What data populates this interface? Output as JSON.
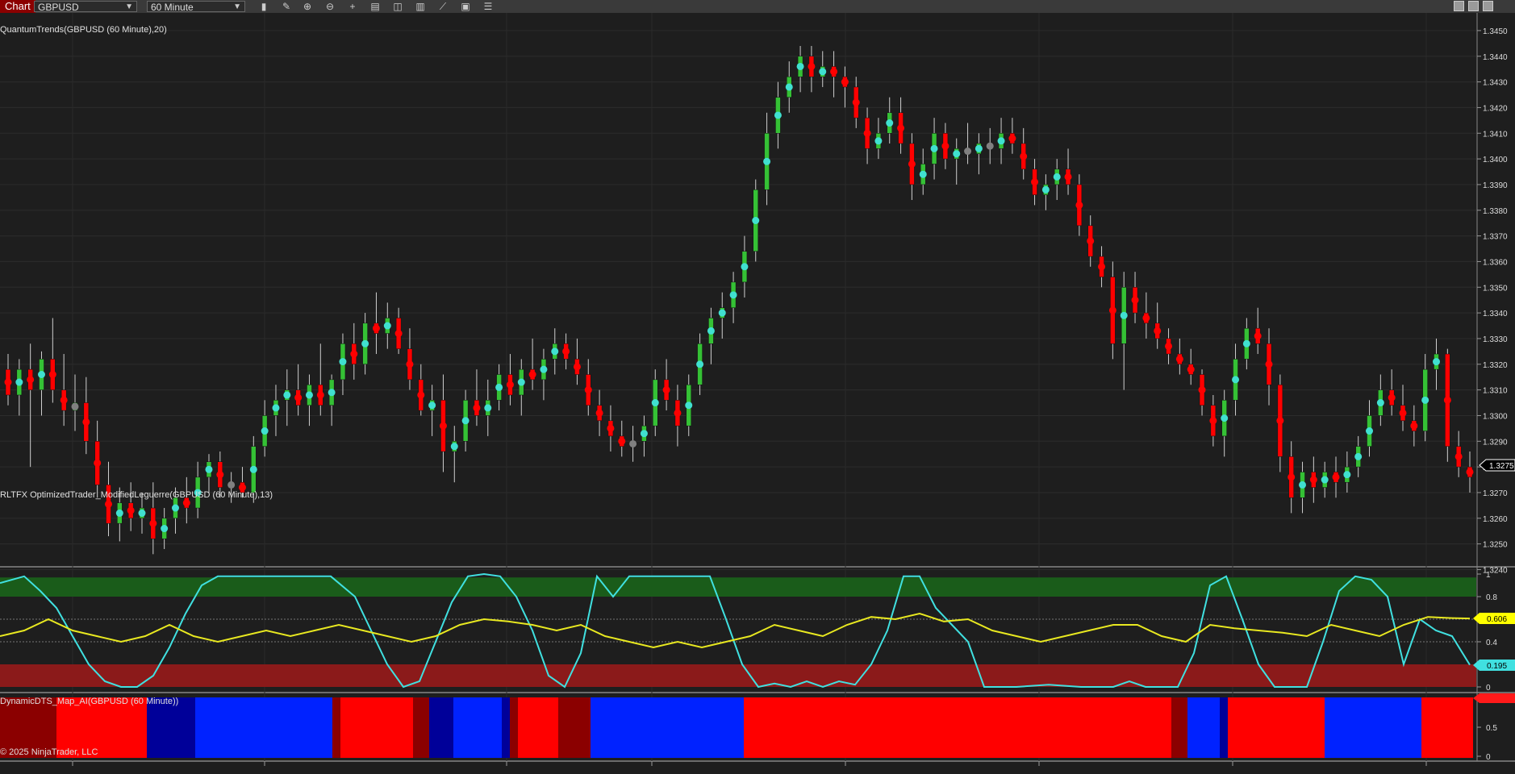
{
  "toolbar": {
    "tab_label": "Chart",
    "instrument": "GBPUSD",
    "interval": "60 Minute",
    "icons": [
      "bar-type-icon",
      "pencil-icon",
      "zoom-in-icon",
      "zoom-out-icon",
      "crosshair-icon",
      "properties-icon",
      "strategies-icon",
      "indicators-icon",
      "drawing-tools-icon",
      "data-box-icon",
      "list-icon"
    ]
  },
  "panels": {
    "price": {
      "label": "QuantumTrends(GBPUSD (60 Minute),20)",
      "ticks": [
        "1.3450",
        "1.3440",
        "1.3430",
        "1.3420",
        "1.3410",
        "1.3400",
        "1.3390",
        "1.3380",
        "1.3370",
        "1.3360",
        "1.3350",
        "1.3340",
        "1.3330",
        "1.3320",
        "1.3310",
        "1.3300",
        "1.3290",
        "1.3280",
        "1.3270",
        "1.3260",
        "1.3250",
        "1.3240"
      ],
      "last_price": "1.3275"
    },
    "oscillator": {
      "label": "RLTFX OptimizedTrader_ModifiedLeguerre(GBPUSD (60 Minute),13)",
      "ticks": [
        "1",
        "0.8",
        "0.6",
        "0.4",
        "0.2",
        "0"
      ],
      "yellow_value": "0.606",
      "cyan_value": "0.195"
    },
    "map": {
      "label": "DynamicDTS_Map_AI(GBPUSD (60 Minute))",
      "copyright": "© 2025 NinjaTrader, LLC",
      "ticks": [
        "1",
        "0.5",
        "0"
      ]
    }
  },
  "colors": {
    "up": "#35c135",
    "down": "#ff0000",
    "dot_up": "#40e0d0",
    "dot_down": "#ff0000",
    "dot_neutral": "#808080",
    "map_blue": "#0022ff",
    "map_navy": "#000099",
    "map_red": "#ff0000",
    "map_darkred": "#8b0000"
  },
  "chart_data": {
    "type": "candlestick",
    "instrument": "GBPUSD",
    "interval": "60 Minute",
    "ylim": [
      1.3237,
      1.3455
    ],
    "candles_ohlc": [
      [
        1.3318,
        1.3324,
        1.3304,
        1.3308
      ],
      [
        1.3308,
        1.3322,
        1.33,
        1.3318
      ],
      [
        1.3318,
        1.3328,
        1.328,
        1.331
      ],
      [
        1.331,
        1.3325,
        1.33,
        1.3322
      ],
      [
        1.3322,
        1.3338,
        1.3305,
        1.331
      ],
      [
        1.331,
        1.3324,
        1.3296,
        1.3302
      ],
      [
        1.3302,
        1.3316,
        1.3294,
        1.3305
      ],
      [
        1.3305,
        1.3315,
        1.3285,
        1.329
      ],
      [
        1.329,
        1.3298,
        1.3268,
        1.3273
      ],
      [
        1.3273,
        1.3282,
        1.3253,
        1.3258
      ],
      [
        1.3258,
        1.3272,
        1.3251,
        1.3266
      ],
      [
        1.3266,
        1.3274,
        1.3255,
        1.326
      ],
      [
        1.326,
        1.327,
        1.3254,
        1.3264
      ],
      [
        1.3264,
        1.3274,
        1.3246,
        1.3252
      ],
      [
        1.3252,
        1.3264,
        1.3248,
        1.326
      ],
      [
        1.326,
        1.3272,
        1.3254,
        1.3268
      ],
      [
        1.3268,
        1.3276,
        1.3258,
        1.3264
      ],
      [
        1.3264,
        1.3282,
        1.326,
        1.3276
      ],
      [
        1.3276,
        1.3285,
        1.327,
        1.3282
      ],
      [
        1.3282,
        1.3286,
        1.3268,
        1.3272
      ],
      [
        1.3272,
        1.3278,
        1.3266,
        1.3274
      ],
      [
        1.3274,
        1.328,
        1.3268,
        1.327
      ],
      [
        1.327,
        1.3292,
        1.3266,
        1.3288
      ],
      [
        1.3288,
        1.3306,
        1.3284,
        1.33
      ],
      [
        1.33,
        1.3312,
        1.3292,
        1.3306
      ],
      [
        1.3306,
        1.3318,
        1.3296,
        1.331
      ],
      [
        1.331,
        1.332,
        1.33,
        1.3304
      ],
      [
        1.3304,
        1.3316,
        1.3296,
        1.3312
      ],
      [
        1.3312,
        1.3328,
        1.33,
        1.3304
      ],
      [
        1.3304,
        1.3316,
        1.3296,
        1.3314
      ],
      [
        1.3314,
        1.3332,
        1.3308,
        1.3328
      ],
      [
        1.3328,
        1.3336,
        1.3314,
        1.332
      ],
      [
        1.332,
        1.334,
        1.3316,
        1.3336
      ],
      [
        1.3336,
        1.3348,
        1.3324,
        1.3332
      ],
      [
        1.3332,
        1.3344,
        1.3326,
        1.3338
      ],
      [
        1.3338,
        1.3342,
        1.3324,
        1.3326
      ],
      [
        1.3326,
        1.3334,
        1.331,
        1.3314
      ],
      [
        1.3314,
        1.332,
        1.33,
        1.3302
      ],
      [
        1.3302,
        1.3312,
        1.3292,
        1.3306
      ],
      [
        1.3306,
        1.3316,
        1.3278,
        1.3286
      ],
      [
        1.3286,
        1.3296,
        1.3274,
        1.329
      ],
      [
        1.329,
        1.331,
        1.3286,
        1.3306
      ],
      [
        1.3306,
        1.3318,
        1.3296,
        1.33
      ],
      [
        1.33,
        1.3314,
        1.3292,
        1.3306
      ],
      [
        1.3306,
        1.332,
        1.3302,
        1.3316
      ],
      [
        1.3316,
        1.3324,
        1.3304,
        1.3308
      ],
      [
        1.3308,
        1.3322,
        1.33,
        1.3318
      ],
      [
        1.3318,
        1.333,
        1.331,
        1.3314
      ],
      [
        1.3314,
        1.3326,
        1.3306,
        1.3322
      ],
      [
        1.3322,
        1.3334,
        1.3316,
        1.3328
      ],
      [
        1.3328,
        1.3332,
        1.3318,
        1.3322
      ],
      [
        1.3322,
        1.333,
        1.3312,
        1.3316
      ],
      [
        1.3316,
        1.3322,
        1.33,
        1.3304
      ],
      [
        1.3304,
        1.331,
        1.3292,
        1.3298
      ],
      [
        1.3298,
        1.3304,
        1.3286,
        1.3292
      ],
      [
        1.3292,
        1.3298,
        1.3284,
        1.3288
      ],
      [
        1.3288,
        1.3296,
        1.3282,
        1.329
      ],
      [
        1.329,
        1.33,
        1.3284,
        1.3296
      ],
      [
        1.3296,
        1.3318,
        1.3292,
        1.3314
      ],
      [
        1.3314,
        1.3322,
        1.3302,
        1.3306
      ],
      [
        1.3306,
        1.3312,
        1.3288,
        1.3296
      ],
      [
        1.3296,
        1.3316,
        1.3292,
        1.3312
      ],
      [
        1.3312,
        1.3332,
        1.3308,
        1.3328
      ],
      [
        1.3328,
        1.3342,
        1.332,
        1.3338
      ],
      [
        1.3338,
        1.3348,
        1.333,
        1.3342
      ],
      [
        1.3342,
        1.3356,
        1.3336,
        1.3352
      ],
      [
        1.3352,
        1.337,
        1.3346,
        1.3364
      ],
      [
        1.3364,
        1.3392,
        1.336,
        1.3388
      ],
      [
        1.3388,
        1.3418,
        1.3382,
        1.341
      ],
      [
        1.341,
        1.343,
        1.3404,
        1.3424
      ],
      [
        1.3424,
        1.3438,
        1.3418,
        1.3432
      ],
      [
        1.3432,
        1.3444,
        1.3426,
        1.344
      ],
      [
        1.344,
        1.3444,
        1.3426,
        1.3432
      ],
      [
        1.3432,
        1.3442,
        1.3428,
        1.3436
      ],
      [
        1.3436,
        1.3442,
        1.3424,
        1.3432
      ],
      [
        1.3432,
        1.3436,
        1.342,
        1.3428
      ],
      [
        1.3428,
        1.3432,
        1.3412,
        1.3416
      ],
      [
        1.3416,
        1.342,
        1.3398,
        1.3404
      ],
      [
        1.3404,
        1.3416,
        1.34,
        1.341
      ],
      [
        1.341,
        1.3424,
        1.3406,
        1.3418
      ],
      [
        1.3418,
        1.3424,
        1.3402,
        1.3406
      ],
      [
        1.3406,
        1.341,
        1.3384,
        1.339
      ],
      [
        1.339,
        1.3404,
        1.3386,
        1.3398
      ],
      [
        1.3398,
        1.3416,
        1.3392,
        1.341
      ],
      [
        1.341,
        1.3414,
        1.3396,
        1.34
      ],
      [
        1.34,
        1.3408,
        1.339,
        1.3404
      ],
      [
        1.3404,
        1.3414,
        1.3398,
        1.3402
      ],
      [
        1.3402,
        1.341,
        1.3394,
        1.3406
      ],
      [
        1.3406,
        1.3412,
        1.3398,
        1.3404
      ],
      [
        1.3404,
        1.3416,
        1.3398,
        1.341
      ],
      [
        1.341,
        1.3416,
        1.3402,
        1.3406
      ],
      [
        1.3406,
        1.3412,
        1.3392,
        1.3396
      ],
      [
        1.3396,
        1.34,
        1.3382,
        1.3386
      ],
      [
        1.3386,
        1.3394,
        1.338,
        1.339
      ],
      [
        1.339,
        1.34,
        1.3384,
        1.3396
      ],
      [
        1.3396,
        1.3404,
        1.3386,
        1.339
      ],
      [
        1.339,
        1.3394,
        1.337,
        1.3374
      ],
      [
        1.3374,
        1.3378,
        1.3358,
        1.3362
      ],
      [
        1.3362,
        1.3366,
        1.335,
        1.3354
      ],
      [
        1.3354,
        1.336,
        1.3322,
        1.3328
      ],
      [
        1.3328,
        1.3356,
        1.331,
        1.335
      ],
      [
        1.335,
        1.3356,
        1.3336,
        1.334
      ],
      [
        1.334,
        1.3348,
        1.333,
        1.3336
      ],
      [
        1.3336,
        1.3344,
        1.3326,
        1.333
      ],
      [
        1.333,
        1.3334,
        1.332,
        1.3324
      ],
      [
        1.3324,
        1.333,
        1.3316,
        1.332
      ],
      [
        1.332,
        1.3326,
        1.3312,
        1.3316
      ],
      [
        1.3316,
        1.3318,
        1.33,
        1.3304
      ],
      [
        1.3304,
        1.3308,
        1.3288,
        1.3292
      ],
      [
        1.3292,
        1.331,
        1.3284,
        1.3306
      ],
      [
        1.3306,
        1.3328,
        1.33,
        1.3322
      ],
      [
        1.3322,
        1.3338,
        1.3318,
        1.3334
      ],
      [
        1.3334,
        1.3342,
        1.3324,
        1.3328
      ],
      [
        1.3328,
        1.3334,
        1.3304,
        1.3312
      ],
      [
        1.3312,
        1.3316,
        1.3278,
        1.3284
      ],
      [
        1.3284,
        1.329,
        1.3262,
        1.3268
      ],
      [
        1.3268,
        1.3282,
        1.3262,
        1.3278
      ],
      [
        1.3278,
        1.3284,
        1.3266,
        1.3272
      ],
      [
        1.3272,
        1.3282,
        1.3268,
        1.3278
      ],
      [
        1.3278,
        1.3284,
        1.3268,
        1.3274
      ],
      [
        1.3274,
        1.3286,
        1.327,
        1.328
      ],
      [
        1.328,
        1.3292,
        1.3276,
        1.3288
      ],
      [
        1.3288,
        1.3306,
        1.3284,
        1.33
      ],
      [
        1.33,
        1.3316,
        1.3296,
        1.331
      ],
      [
        1.331,
        1.3318,
        1.33,
        1.3304
      ],
      [
        1.3304,
        1.3312,
        1.3294,
        1.3298
      ],
      [
        1.3298,
        1.3304,
        1.3288,
        1.3294
      ],
      [
        1.3294,
        1.3324,
        1.329,
        1.3318
      ],
      [
        1.3318,
        1.333,
        1.331,
        1.3324
      ],
      [
        1.3324,
        1.3326,
        1.3282,
        1.3288
      ],
      [
        1.3288,
        1.3294,
        1.3276,
        1.328
      ],
      [
        1.328,
        1.3286,
        1.327,
        1.3276
      ]
    ]
  }
}
